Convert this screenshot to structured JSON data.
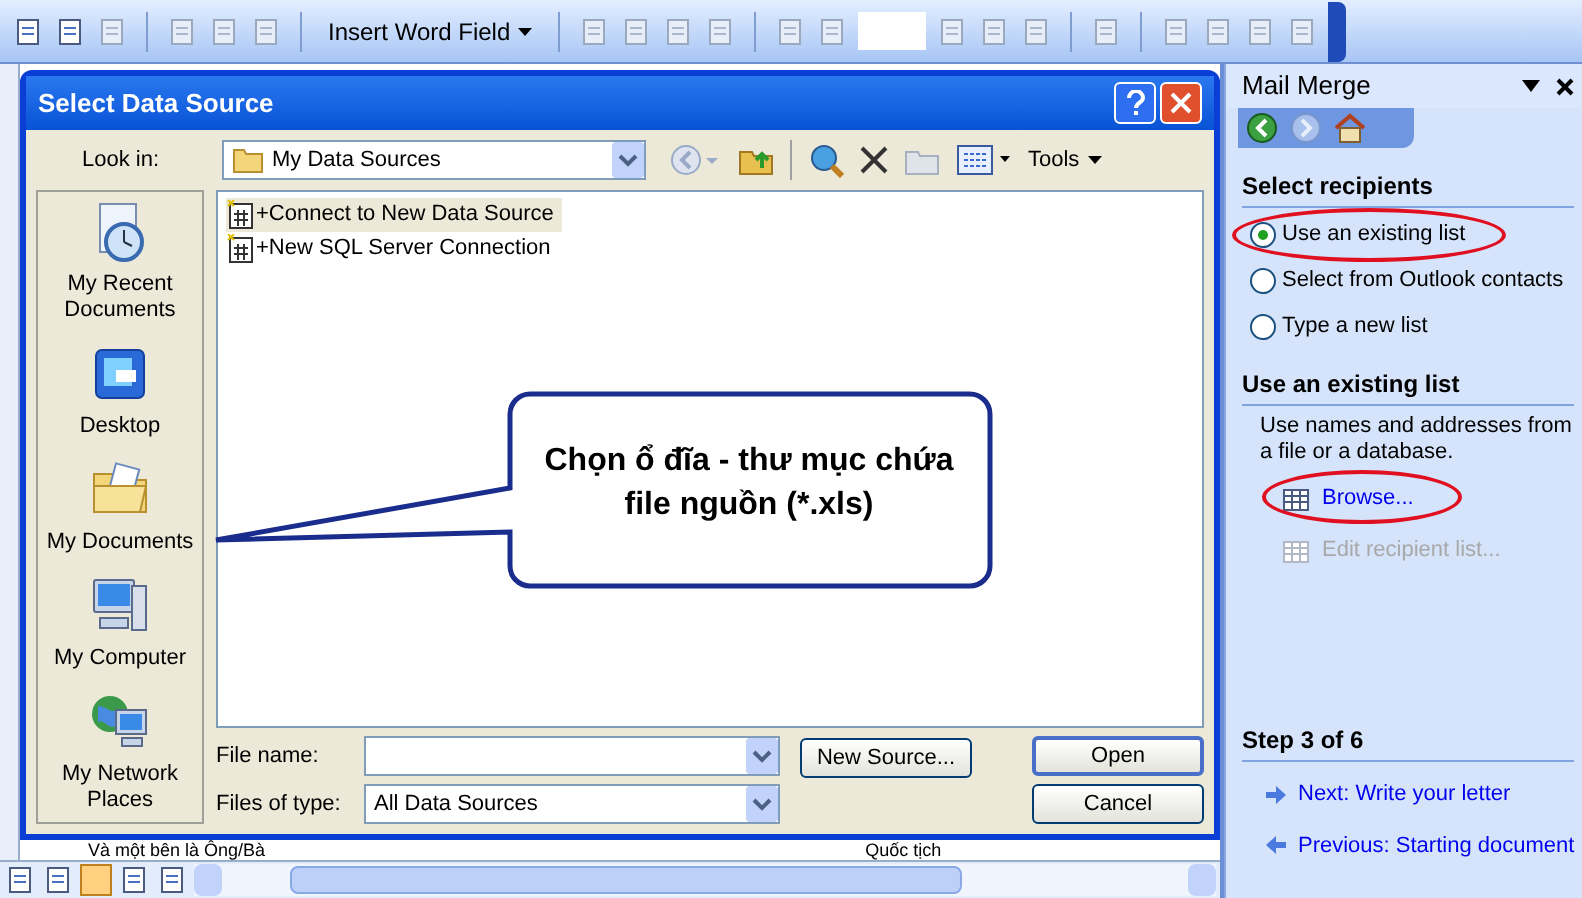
{
  "toolbar": {
    "word_field_button": "Insert Word Field"
  },
  "dialog": {
    "title": "Select Data Source",
    "look_in_label": "Look in:",
    "look_in_value": "My Data Sources",
    "tools_menu": "Tools",
    "places": [
      {
        "label": "My Recent Documents",
        "kind": "recent"
      },
      {
        "label": "Desktop",
        "kind": "desktop"
      },
      {
        "label": "My Documents",
        "kind": "documents"
      },
      {
        "label": "My Computer",
        "kind": "computer"
      },
      {
        "label": "My Network Places",
        "kind": "network"
      }
    ],
    "files": [
      {
        "name": "+Connect to New Data Source",
        "selected": true
      },
      {
        "name": "+New SQL Server Connection",
        "selected": false
      }
    ],
    "file_name_label": "File name:",
    "files_of_type_label": "Files of type:",
    "files_of_type_value": "All Data Sources",
    "new_source_button": "New Source...",
    "open_button": "Open",
    "cancel_button": "Cancel"
  },
  "callout": {
    "text": "Chọn ổ đĩa - thư mục chứa file nguồn (*.xls)"
  },
  "document": {
    "row_text": "Và một bên là Ông/Bà",
    "row_text_2": "Quốc tịch"
  },
  "task_pane": {
    "title": "Mail Merge",
    "select_heading": "Select recipients",
    "options": [
      {
        "label": "Use an existing list",
        "selected": true,
        "circled": true
      },
      {
        "label": "Select from Outlook contacts",
        "selected": false,
        "circled": false
      },
      {
        "label": "Type a new list",
        "selected": false,
        "circled": false
      }
    ],
    "list_heading": "Use an existing list",
    "description": "Use names and addresses from a file or a database.",
    "actions": [
      {
        "label": "Browse...",
        "disabled": false,
        "circled": true
      },
      {
        "label": "Edit recipient list...",
        "disabled": true,
        "circled": false
      }
    ],
    "step": "Step 3 of 6",
    "nav": [
      {
        "label": "Next: Write your letter",
        "kind": "next"
      },
      {
        "label": "Previous: Starting document",
        "kind": "previous"
      }
    ]
  }
}
